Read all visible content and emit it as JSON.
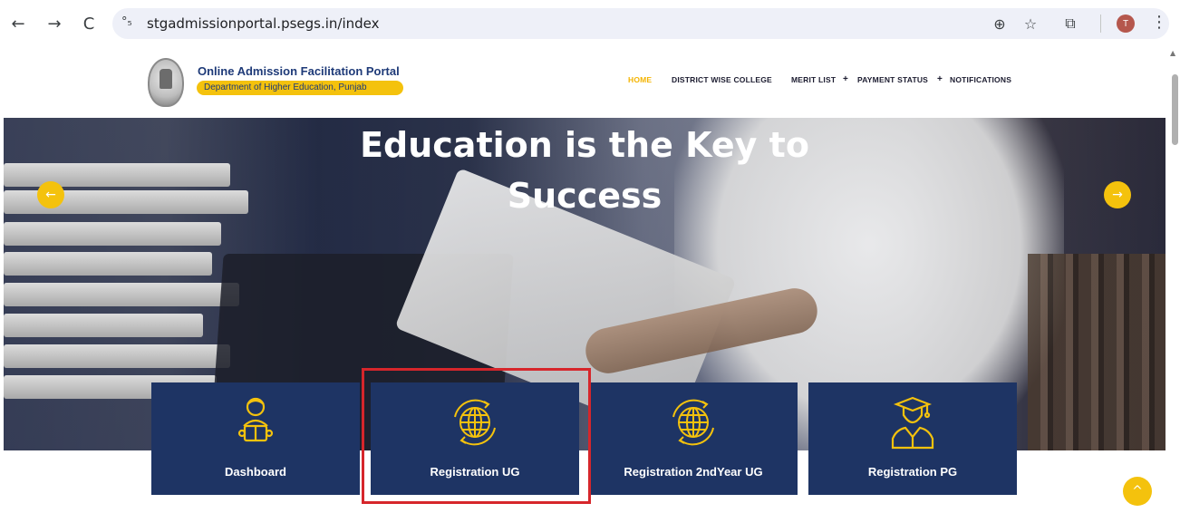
{
  "browser": {
    "url": "stgadmissionportal.psegs.in/index",
    "back_icon": "←",
    "forward_icon": "→",
    "reload_icon": "C",
    "site_info_icon": "°₅",
    "zoom_icon": "⊕",
    "star_icon": "☆",
    "extensions_icon": "⧉",
    "profile_initial": "T",
    "menu_icon": "⋮"
  },
  "header": {
    "portal_title": "Online Admission Facilitation Portal",
    "department": "Department of Higher Education, Punjab",
    "nav": {
      "home": "HOME",
      "district": "DISTRICT WISE COLLEGE",
      "merit": "MERIT LIST",
      "payment": "PAYMENT STATUS",
      "notifications": "NOTIFICATIONS",
      "plus": "+"
    }
  },
  "hero": {
    "title_line1": "Education is the Key to",
    "title_line2": "Success",
    "prev_icon": "←",
    "next_icon": "→"
  },
  "cards": [
    {
      "label": "Dashboard",
      "icon": "student-reading-icon"
    },
    {
      "label": "Registration UG",
      "icon": "globe-icon"
    },
    {
      "label": "Registration 2ndYear UG",
      "icon": "globe-icon"
    },
    {
      "label": "Registration PG",
      "icon": "graduate-icon"
    }
  ],
  "back_to_top_icon": "^",
  "colors": {
    "accent": "#f4c20d",
    "card_bg": "#1e3464",
    "highlight": "#d6262b",
    "nav_active": "#f4b400"
  }
}
